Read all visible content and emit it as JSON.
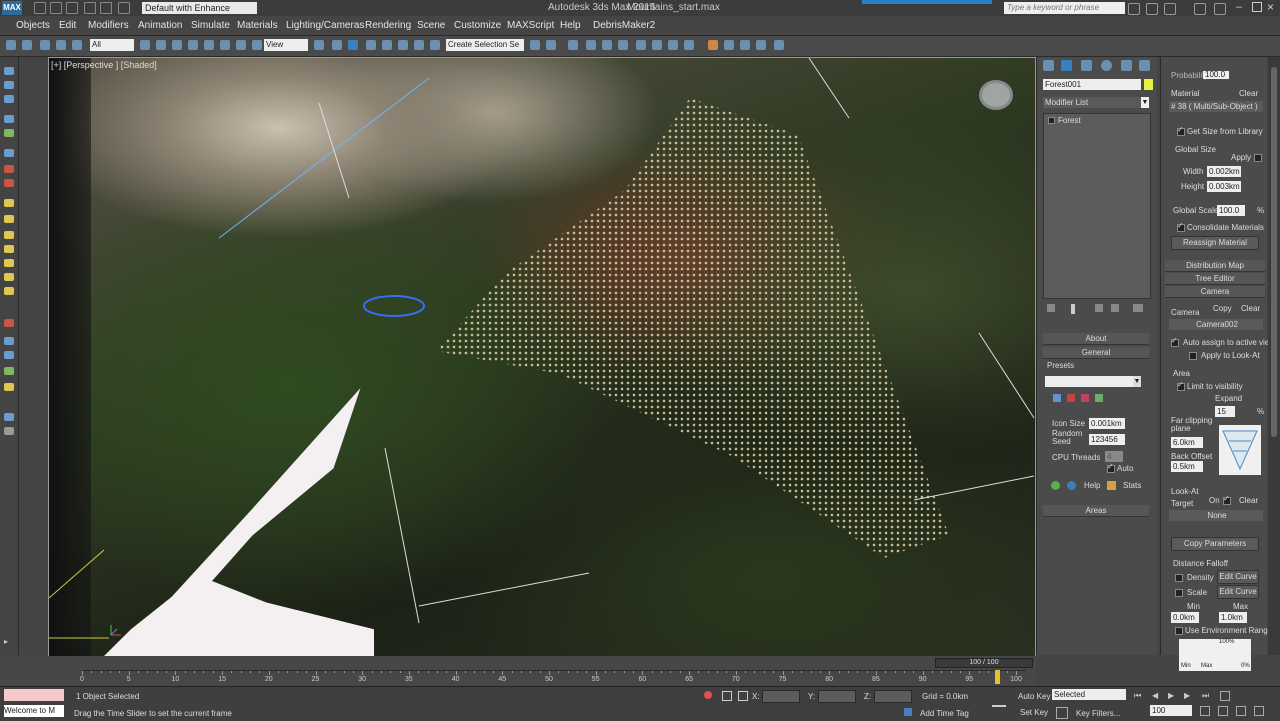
{
  "titlebar": {
    "logo": "MAX",
    "workspace": "Default with Enhance",
    "app_title": "Autodesk 3ds Max 2015",
    "file_title": "Mountains_start.max",
    "search_placeholder": "Type a keyword or phrase"
  },
  "menu": [
    "Objects",
    "Edit",
    "Modifiers",
    "Animation",
    "Simulate",
    "Materials",
    "Lighting/Cameras",
    "Rendering",
    "Scene",
    "Customize",
    "MAXScript",
    "Help",
    "DebrisMaker2"
  ],
  "toolbar": {
    "filter": "All",
    "view": "View",
    "selection_set": "Create Selection Se"
  },
  "viewport": {
    "label": "[+] [Perspective ] [Shaded]"
  },
  "modify_panel": {
    "object_name": "Forest001",
    "modifier_list": "Modifier List",
    "stack_item": "Forest",
    "rollouts": {
      "about": "About",
      "general": "General",
      "areas": "Areas"
    },
    "presets_label": "Presets",
    "icon_size_label": "Icon Size",
    "icon_size": "0.001km",
    "random_seed_label": "Random Seed",
    "random_seed": "123456",
    "cpu_threads_label": "CPU Threads",
    "cpu_threads": "4",
    "auto_label": "Auto",
    "help_label": "Help",
    "stats_label": "Stats"
  },
  "rollout2": {
    "probability_label": "Probability",
    "probability": "100.0",
    "material_label": "Material",
    "clear_label": "Clear",
    "material_value": "# 38 ( Multi/Sub-Object )",
    "get_size": "Get Size from Library",
    "global_size": "Global Size",
    "apply_label": "Apply",
    "width_label": "Width",
    "width": "0.002km",
    "height_label": "Height",
    "height": "0.003km",
    "global_scale_label": "Global Scale",
    "global_scale": "100.0",
    "percent": "%",
    "consolidate": "Consolidate Materials",
    "reassign": "Reassign Material",
    "distribution_map": "Distribution Map",
    "tree_editor": "Tree Editor",
    "camera_head": "Camera",
    "camera_label": "Camera",
    "copy_label": "Copy",
    "camera_value": "Camera002",
    "auto_assign": "Auto assign to active view",
    "apply_lookat": "Apply to Look-At",
    "area_label": "Area",
    "limit_visibility": "Limit to visibility",
    "expand_label": "Expand",
    "expand": "15",
    "far_clipping": "Far clipping plane",
    "far_value": "6.0km",
    "back_offset": "Back Offset",
    "back_value": "0.5km",
    "look_at": "Look-At",
    "target_label": "Target",
    "on_label": "On",
    "none_label": "None",
    "copy_params": "Copy Parameters",
    "distance_falloff": "Distance Falloff",
    "density_label": "Density",
    "scale_label": "Scale",
    "edit_curve": "Edit Curve",
    "min_label": "Min",
    "max_label": "Max",
    "min_value": "0.0km",
    "max_value": "1.0km",
    "use_env_range": "Use Environment Range",
    "curve_max": "100%",
    "curve_min_axis": "Min",
    "curve_max_axis": "Max",
    "curve_zero": "0%"
  },
  "timeline": {
    "frame_display": "100 / 100",
    "ticks": [
      0,
      5,
      10,
      15,
      20,
      25,
      30,
      35,
      40,
      45,
      50,
      55,
      60,
      65,
      70,
      75,
      80,
      85,
      90,
      95,
      100
    ]
  },
  "status": {
    "script_listener": "Welcome to M",
    "selected_text": "1 Object Selected",
    "prompt": "Drag the Time Slider to set the current frame",
    "x_label": "X:",
    "y_label": "Y:",
    "z_label": "Z:",
    "grid": "Grid = 0.0km",
    "add_time_tag": "Add Time Tag",
    "auto_key": "Auto Key",
    "set_key": "Set Key",
    "key_mode": "Selected",
    "key_filters": "Key Filters...",
    "frame": "100"
  },
  "colors": {
    "object_color": "#e8f044",
    "accent": "#2a7fc9"
  }
}
